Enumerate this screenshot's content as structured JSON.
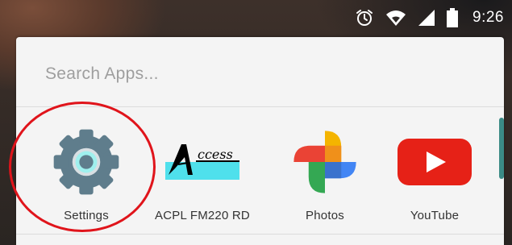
{
  "status_bar": {
    "time": "9:26",
    "icons": [
      "alarm-icon",
      "wifi-icon",
      "signal-icon",
      "battery-icon"
    ]
  },
  "search": {
    "placeholder": "Search Apps..."
  },
  "apps": [
    {
      "label": "Settings",
      "icon": "settings-gear-icon"
    },
    {
      "label": "ACPL FM220 RD",
      "icon": "access-logo-icon",
      "logo_text": "ccess"
    },
    {
      "label": "Photos",
      "icon": "photos-pinwheel-icon"
    },
    {
      "label": "YouTube",
      "icon": "youtube-play-icon"
    }
  ],
  "colors": {
    "annotation_circle": "#e0141b",
    "scroll_thumb": "#3b8b86",
    "youtube_red": "#e62117",
    "settings_gray": "#5f7d8c",
    "access_cyan": "#4fe0ec"
  }
}
